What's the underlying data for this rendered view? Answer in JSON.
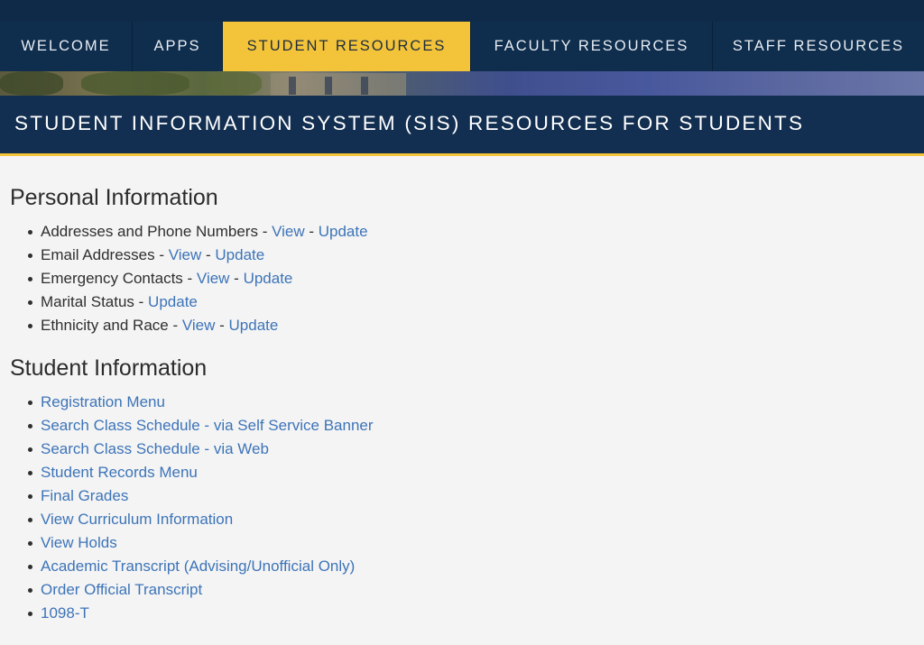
{
  "nav": {
    "items": [
      {
        "label": "WELCOME",
        "active": false
      },
      {
        "label": "APPS",
        "active": false
      },
      {
        "label": "STUDENT RESOURCES",
        "active": true
      },
      {
        "label": "FACULTY RESOURCES",
        "active": false
      },
      {
        "label": "STAFF RESOURCES",
        "active": false
      }
    ]
  },
  "banner": {
    "title": "STUDENT INFORMATION SYSTEM (SIS) RESOURCES FOR STUDENTS"
  },
  "personal": {
    "title": "Personal Information",
    "items": [
      {
        "label": "Addresses and Phone Numbers",
        "sep": " - ",
        "link1": "View",
        "sep2": " - ",
        "link2": "Update"
      },
      {
        "label": "Email Addresses",
        "sep": " - ",
        "link1": "View",
        "sep2": " - ",
        "link2": "Update"
      },
      {
        "label": "Emergency Contacts",
        "sep": " - ",
        "link1": "View",
        "sep2": " - ",
        "link2": "Update"
      },
      {
        "label": "Marital Status",
        "sep": " - ",
        "link1": "Update"
      },
      {
        "label": "Ethnicity and Race",
        "sep": " - ",
        "link1": "View",
        "sep2": " - ",
        "link2": "Update"
      }
    ]
  },
  "student": {
    "title": "Student Information",
    "links": [
      "Registration Menu",
      "Search Class Schedule - via Self Service Banner",
      "Search Class Schedule - via Web",
      "Student Records Menu",
      "Final Grades",
      "View Curriculum Information",
      "View Holds",
      "Academic Transcript (Advising/Unofficial Only)",
      "Order Official Transcript",
      "1098-T"
    ]
  },
  "colors": {
    "nav_bg": "#0f2d4d",
    "accent": "#f3c43a",
    "banner_bg": "#122e50",
    "link": "#3d74b8",
    "page_bg": "#f4f4f4"
  }
}
